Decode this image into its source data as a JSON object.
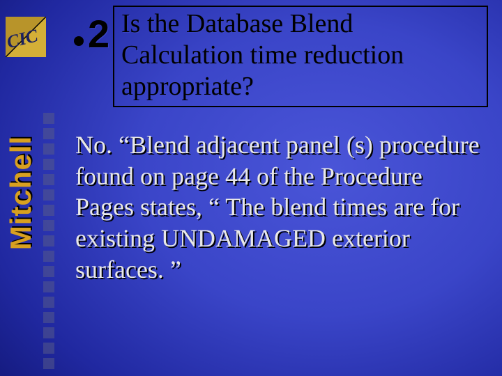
{
  "logo": {
    "text": "CIC",
    "bg": "#c8a22c",
    "fg": "#1a2060"
  },
  "bullet": {
    "number": "2"
  },
  "question": "Is the Database Blend Calculation time reduction appropriate?",
  "vertical_label": "Mitchell",
  "answer": "No.  “Blend adjacent panel (s) procedure found on page 44 of the Procedure Pages states, “ The blend times are for existing UNDAMAGED exterior surfaces. ”",
  "colors": {
    "accent": "#d8a020",
    "text_light": "#e8e8e8",
    "text_dark": "#000000"
  }
}
